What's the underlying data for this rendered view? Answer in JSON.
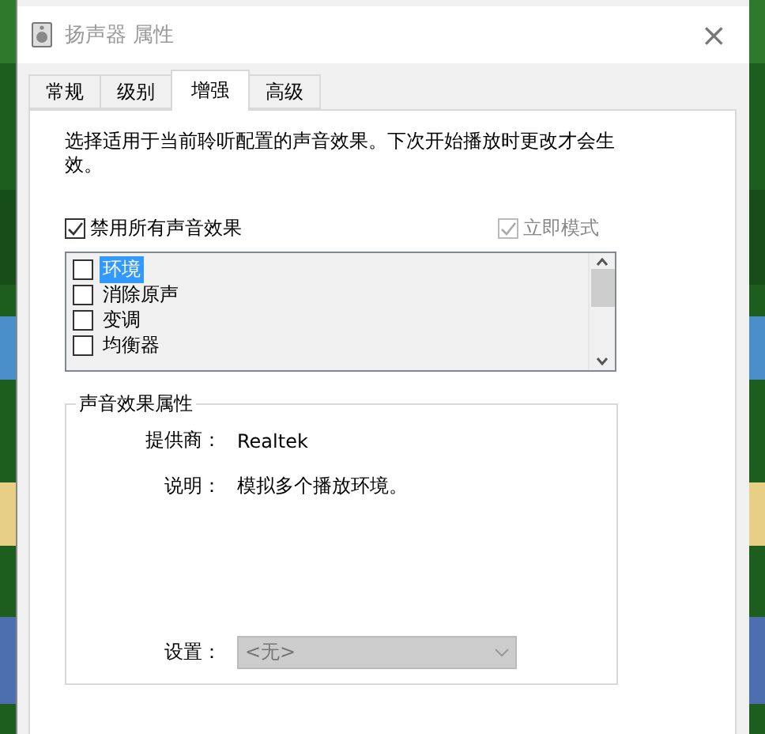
{
  "window": {
    "title": "扬声器 属性",
    "close": "×"
  },
  "tabs": [
    {
      "label": "常规",
      "selected": false
    },
    {
      "label": "级别",
      "selected": false
    },
    {
      "label": "增强",
      "selected": true
    },
    {
      "label": "高级",
      "selected": false
    }
  ],
  "description": "选择适用于当前聆听配置的声音效果。下次开始播放时更改才会生效。",
  "disable_all": {
    "label": "禁用所有声音效果",
    "checked": true,
    "disabled": false
  },
  "immediate_mode": {
    "label": "立即模式",
    "checked": true,
    "disabled": true
  },
  "effects": [
    {
      "label": "环境",
      "checked": false,
      "selected": true
    },
    {
      "label": "消除原声",
      "checked": false,
      "selected": false
    },
    {
      "label": "变调",
      "checked": false,
      "selected": false
    },
    {
      "label": "均衡器",
      "checked": false,
      "selected": false
    }
  ],
  "properties": {
    "title": "声音效果属性",
    "rows": [
      {
        "label": "提供商：",
        "value": "Realtek"
      },
      {
        "label": "说明：",
        "value": "模拟多个播放环境。"
      }
    ],
    "setting": {
      "label": "设置：",
      "value": "<无>",
      "disabled": true
    }
  }
}
